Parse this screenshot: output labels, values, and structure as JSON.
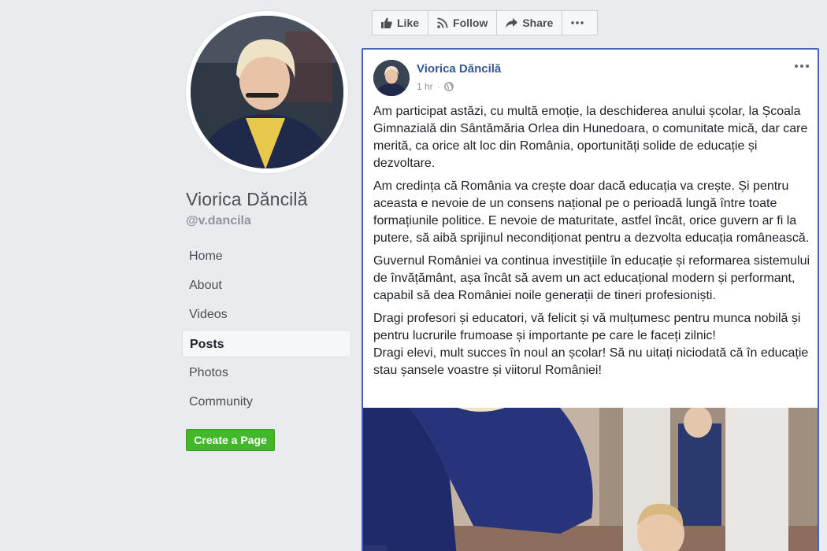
{
  "page": {
    "name": "Viorica Dăncilă",
    "handle": "@v.dancila"
  },
  "nav": {
    "items": [
      {
        "label": "Home"
      },
      {
        "label": "About"
      },
      {
        "label": "Videos"
      },
      {
        "label": "Posts",
        "active": true
      },
      {
        "label": "Photos"
      },
      {
        "label": "Community"
      }
    ]
  },
  "create_page_label": "Create a Page",
  "action_bar": {
    "like": "Like",
    "follow": "Follow",
    "share": "Share"
  },
  "post": {
    "author": "Viorica Dăncilă",
    "time": "1 hr",
    "paragraphs": [
      "Am participat astăzi, cu multă emoție, la deschiderea anului școlar, la Școala Gimnazială din Sântămăria Orlea din Hunedoara, o comunitate mică, dar care merită, ca orice alt loc din România, oportunități solide de educație și dezvoltare.",
      "Am credința că România va crește doar dacă educația va crește. Și pentru aceasta e nevoie de un consens național pe o perioadă lungă între toate formațiunile politice. E nevoie de maturitate, astfel încât, orice guvern ar fi la putere, să aibă sprijinul necondiționat pentru a dezvolta educația românească.",
      "Guvernul României va continua investițiile în educație și reformarea sistemului de învățământ, așa încât să avem un act educațional modern și performant, capabil să dea României noile generații de tineri profesioniști.",
      "Dragi profesori și educatori, vă felicit și vă mulțumesc pentru munca nobilă și pentru lucrurile frumoase și importante pe care le faceți zilnic!",
      "Dragi elevi, mult succes în noul an școlar! Să nu uitați niciodată că în educație stau șansele voastre și viitorul României!"
    ]
  },
  "icons": {
    "like": "thumbs-up-icon",
    "follow": "rss-icon",
    "share": "share-arrow-icon",
    "more": "more-dots-icon",
    "audience": "globe-icon"
  },
  "colors": {
    "link_blue": "#365899",
    "create_green": "#42b72a",
    "focus_border": "#4a63b8",
    "background": "#e9ebee"
  }
}
